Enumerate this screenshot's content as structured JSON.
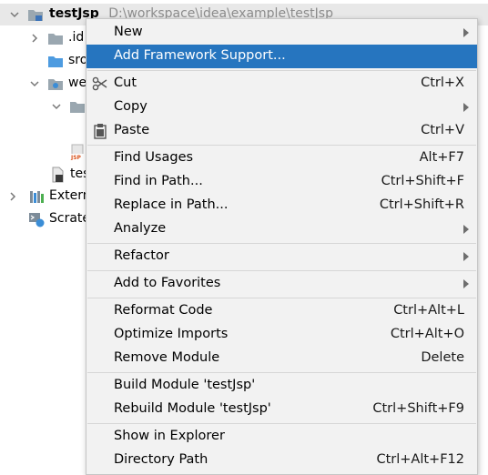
{
  "tree": {
    "root": {
      "name": "testJsp",
      "path": "D:\\workspace\\idea\\example\\testJsp"
    },
    "items": [
      {
        "label": ".id",
        "icon": "folder-icon"
      },
      {
        "label": "sro",
        "icon": "source-folder-icon"
      },
      {
        "label": "we",
        "icon": "web-folder-icon"
      },
      {
        "label": "",
        "icon": "folder-icon"
      },
      {
        "label": "",
        "icon": "jsp-file-icon"
      },
      {
        "label": "tes",
        "icon": "iml-file-icon"
      },
      {
        "label": "Extern",
        "icon": "libraries-icon"
      },
      {
        "label": "Scrate",
        "icon": "scratches-icon"
      }
    ]
  },
  "menu": {
    "items": [
      {
        "label": "New",
        "shortcut": "",
        "submenu": true
      },
      {
        "label": "Add Framework Support...",
        "shortcut": "",
        "submenu": false,
        "selected": true
      },
      {
        "label": "Cut",
        "shortcut": "Ctrl+X",
        "submenu": false,
        "icon": "scissors-icon"
      },
      {
        "label": "Copy",
        "shortcut": "",
        "submenu": true
      },
      {
        "label": "Paste",
        "shortcut": "Ctrl+V",
        "submenu": false,
        "icon": "clipboard-icon"
      },
      {
        "label": "Find Usages",
        "shortcut": "Alt+F7",
        "submenu": false
      },
      {
        "label": "Find in Path...",
        "shortcut": "Ctrl+Shift+F",
        "submenu": false
      },
      {
        "label": "Replace in Path...",
        "shortcut": "Ctrl+Shift+R",
        "submenu": false
      },
      {
        "label": "Analyze",
        "shortcut": "",
        "submenu": true
      },
      {
        "label": "Refactor",
        "shortcut": "",
        "submenu": true
      },
      {
        "label": "Add to Favorites",
        "shortcut": "",
        "submenu": true
      },
      {
        "label": "Reformat Code",
        "shortcut": "Ctrl+Alt+L",
        "submenu": false
      },
      {
        "label": "Optimize Imports",
        "shortcut": "Ctrl+Alt+O",
        "submenu": false
      },
      {
        "label": "Remove Module",
        "shortcut": "Delete",
        "submenu": false
      },
      {
        "label": "Build Module 'testJsp'",
        "shortcut": "",
        "submenu": false
      },
      {
        "label": "Rebuild Module 'testJsp'",
        "shortcut": "Ctrl+Shift+F9",
        "submenu": false
      },
      {
        "label": "Show in Explorer",
        "shortcut": "",
        "submenu": false
      },
      {
        "label": "Directory Path",
        "shortcut": "Ctrl+Alt+F12",
        "submenu": false
      }
    ]
  },
  "colors": {
    "selection": "#2675bf",
    "menu_bg": "#f2f2f2",
    "root_row_bg": "#e8e8e8"
  }
}
